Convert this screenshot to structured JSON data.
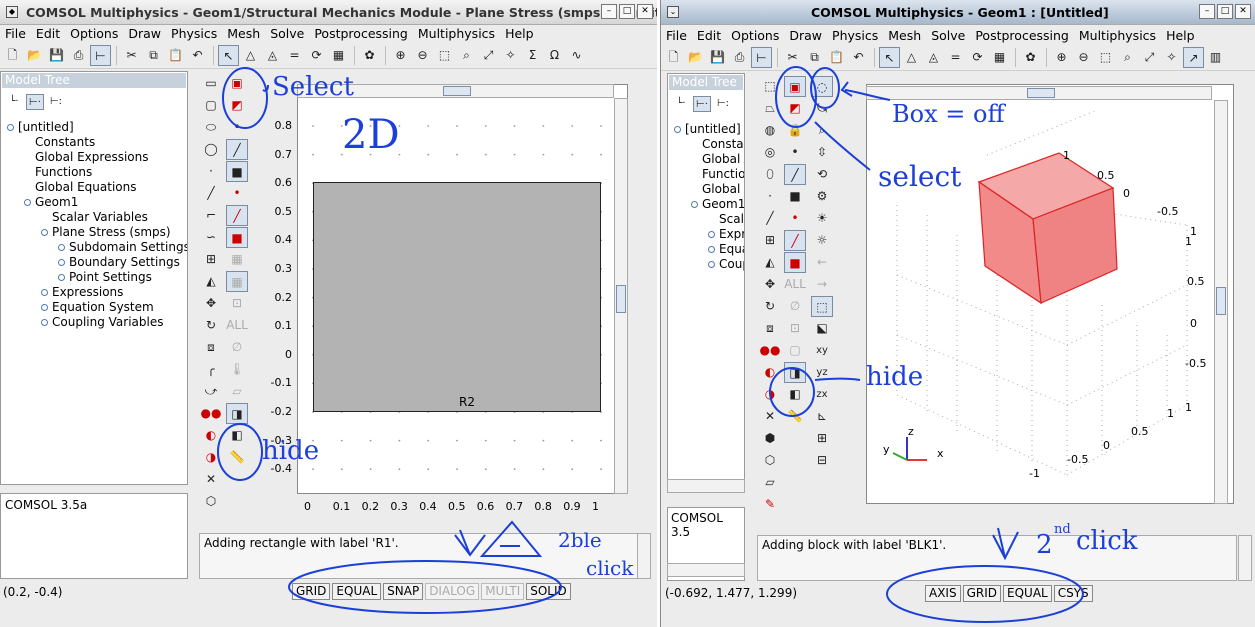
{
  "window1": {
    "title": "COMSOL Multiphysics - Geom1/Structural Mechanics Module - Plane Stress (smps) : [Untit",
    "menus": [
      "File",
      "Edit",
      "Options",
      "Draw",
      "Physics",
      "Mesh",
      "Solve",
      "Postprocessing",
      "Multiphysics",
      "Help"
    ],
    "tree_header": "Model Tree",
    "tree": [
      {
        "label": "[untitled]",
        "level": 0
      },
      {
        "label": "Constants",
        "level": 1
      },
      {
        "label": "Global Expressions",
        "level": 1
      },
      {
        "label": "Functions",
        "level": 1
      },
      {
        "label": "Global Equations",
        "level": 1
      },
      {
        "label": "Geom1",
        "level": 1
      },
      {
        "label": "Scalar Variables",
        "level": 2
      },
      {
        "label": "Plane Stress (smps)",
        "level": 2
      },
      {
        "label": "Subdomain Settings",
        "level": 3
      },
      {
        "label": "Boundary Settings",
        "level": 3
      },
      {
        "label": "Point Settings",
        "level": 3
      },
      {
        "label": "Expressions",
        "level": 2
      },
      {
        "label": "Equation System",
        "level": 2
      },
      {
        "label": "Coupling Variables",
        "level": 2
      }
    ],
    "info_text": "COMSOL 3.5a",
    "y_ticks": [
      "0.8",
      "0.7",
      "0.6",
      "0.5",
      "0.4",
      "0.3",
      "0.2",
      "0.1",
      "0",
      "-0.1",
      "-0.2",
      "-0.3",
      "-0.4"
    ],
    "x_ticks": [
      "0",
      "0.1",
      "0.2",
      "0.3",
      "0.4",
      "0.5",
      "0.6",
      "0.7",
      "0.8",
      "0.9",
      "1"
    ],
    "object_label": "R2",
    "message": "Adding rectangle with label 'R1'.",
    "coords": "(0.2, -0.4)",
    "status_buttons": [
      {
        "label": "GRID",
        "disabled": false
      },
      {
        "label": "EQUAL",
        "disabled": false
      },
      {
        "label": "SNAP",
        "disabled": false
      },
      {
        "label": "DIALOG",
        "disabled": true
      },
      {
        "label": "MULTI",
        "disabled": true
      },
      {
        "label": "SOLID",
        "disabled": false
      }
    ]
  },
  "window2": {
    "title": "COMSOL Multiphysics - Geom1 : [Untitled]",
    "menus": [
      "File",
      "Edit",
      "Options",
      "Draw",
      "Physics",
      "Mesh",
      "Solve",
      "Postprocessing",
      "Multiphysics",
      "Help"
    ],
    "tree_header": "Model Tree",
    "tree": [
      {
        "label": "[untitled]",
        "level": 0
      },
      {
        "label": "Constar",
        "level": 1
      },
      {
        "label": "Global",
        "level": 1
      },
      {
        "label": "Functio",
        "level": 1
      },
      {
        "label": "Global",
        "level": 1
      },
      {
        "label": "Geom1",
        "level": 1
      },
      {
        "label": "Scala",
        "level": 2
      },
      {
        "label": "Expr",
        "level": 2
      },
      {
        "label": "Equa",
        "level": 2
      },
      {
        "label": "Coup",
        "level": 2
      }
    ],
    "info_text": "COMSOL 3.5",
    "message": "Adding block with label 'BLK1'.",
    "coords": "(-0.692, 1.477, 1.299)",
    "axis_labels": {
      "y": "y",
      "z": "z",
      "x": "x"
    },
    "tick_labels": {
      "top_1": "1",
      "top_05": "0.5",
      "top_0": "0",
      "top_m05": "-0.5",
      "right_1a": "1",
      "right_1b": "1",
      "right_05": "0.5",
      "right_0": "0",
      "right_m05": "-0.5",
      "right_1c": "1",
      "bot_1": "1",
      "bot_05": "0.5",
      "bot_0": "0",
      "bot_m05": "-0.5",
      "bot_m1": "-1"
    },
    "status_buttons": [
      {
        "label": "AXIS",
        "disabled": false
      },
      {
        "label": "GRID",
        "disabled": false
      },
      {
        "label": "EQUAL",
        "disabled": false
      },
      {
        "label": "CSYS",
        "disabled": false
      }
    ]
  },
  "annotations": {
    "select1": "Select",
    "twoD": "2D",
    "hide1": "hide",
    "twoble": "2ble",
    "click1": "click",
    "box_off": "Box = off",
    "select2": "select",
    "hide2": "hide",
    "twond": "2",
    "nd": "nd",
    "click2": "click"
  },
  "colors": {
    "selected_fill": "#f28a8a",
    "rect_fill": "#b3b3b3",
    "ink": "#1b3fd8",
    "tree_header": "#c6d1dc"
  }
}
